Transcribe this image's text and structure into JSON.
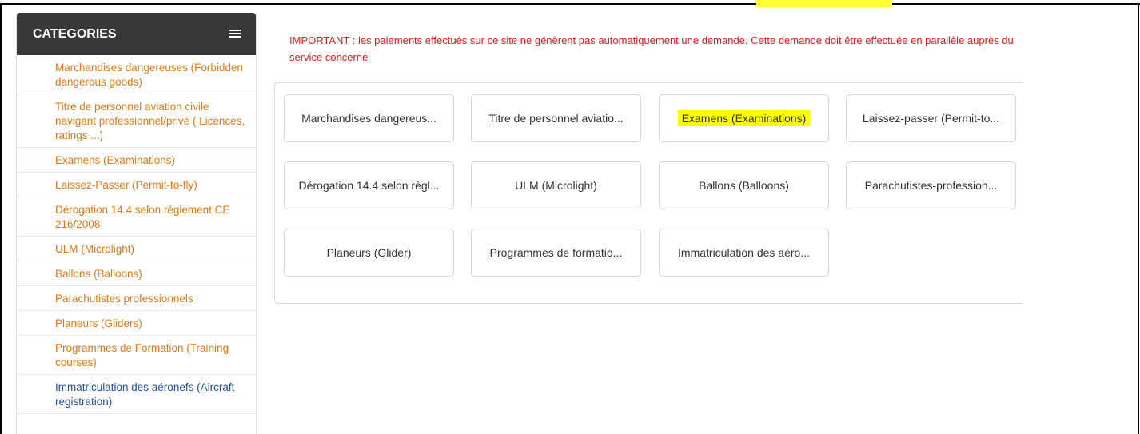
{
  "colors": {
    "header_bg": "#383838",
    "category_link": "#e47911",
    "category_active": "#1f4e9c",
    "notice_text": "#e0191b",
    "highlight": "#ffff00"
  },
  "sidebar": {
    "title": "CATEGORIES",
    "menu_icon": "hamburger-menu-icon",
    "items": [
      {
        "label": "Marchandises dangereuses (Forbidden dangerous goods)"
      },
      {
        "label": "Titre de personnel aviation civile navigant professionnel/privé ( Licences, ratings ...)"
      },
      {
        "label": "Examens (Examinations)"
      },
      {
        "label": "Laissez-Passer (Permit-to-fly)"
      },
      {
        "label": "Dérogation 14.4 selon règlement CE 216/2008"
      },
      {
        "label": "ULM (Microlight)"
      },
      {
        "label": "Ballons (Balloons)"
      },
      {
        "label": "Parachutistes professionnels"
      },
      {
        "label": "Planeurs (Gliders)"
      },
      {
        "label": "Programmes de Formation (Training courses)"
      },
      {
        "label": "Immatriculation des aéronefs (Aircraft registration)",
        "active": true
      }
    ]
  },
  "notice": "IMPORTANT : les paiements effectués sur ce site ne génèrent pas automatiquement une demande. Cette demande doit être effectuée en parallèle auprès du service concerné",
  "tiles": [
    {
      "label": "Marchandises dangereus..."
    },
    {
      "label": "Titre de personnel aviatio..."
    },
    {
      "label": "Examens (Examinations)",
      "highlighted": true
    },
    {
      "label": "Laissez-passer (Permit-to..."
    },
    {
      "label": "Dérogation 14.4 selon règl..."
    },
    {
      "label": "ULM (Microlight)"
    },
    {
      "label": "Ballons (Balloons)"
    },
    {
      "label": "Parachutistes-profession..."
    },
    {
      "label": "Planeurs (Glider)"
    },
    {
      "label": "Programmes de formatio..."
    },
    {
      "label": "Immatriculation des aéro..."
    }
  ]
}
